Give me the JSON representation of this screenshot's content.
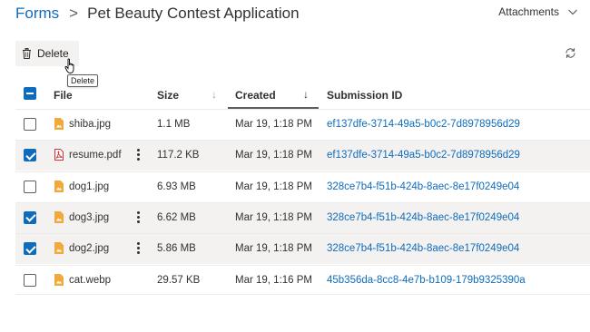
{
  "breadcrumb": {
    "root": "Forms",
    "separator": ">",
    "title": "Pet Beauty Contest Application"
  },
  "attachments_label": "Attachments",
  "toolbar": {
    "delete_label": "Delete",
    "tooltip": "Delete"
  },
  "columns": {
    "file": "File",
    "size": "Size",
    "created": "Created",
    "submission_id": "Submission ID"
  },
  "colors": {
    "accent": "#0f6cbd",
    "image_icon": "#f2a93b",
    "pdf_icon": "#d13438"
  },
  "rows": [
    {
      "name": "shiba.jpg",
      "size": "1.1 MB",
      "created": "Mar 19, 1:18 PM",
      "submission_id": "ef137dfe-3714-49a5-b0c2-7d8978956d29",
      "selected": false,
      "type": "image",
      "icon": "image-file-icon"
    },
    {
      "name": "resume.pdf",
      "size": "117.2 KB",
      "created": "Mar 19, 1:18 PM",
      "submission_id": "ef137dfe-3714-49a5-b0c2-7d8978956d29",
      "selected": true,
      "type": "pdf",
      "icon": "pdf-file-icon"
    },
    {
      "name": "dog1.jpg",
      "size": "6.93 MB",
      "created": "Mar 19, 1:18 PM",
      "submission_id": "328ce7b4-f51b-424b-8aec-8e17f0249e04",
      "selected": false,
      "type": "image",
      "icon": "image-file-icon"
    },
    {
      "name": "dog3.jpg",
      "size": "6.62 MB",
      "created": "Mar 19, 1:18 PM",
      "submission_id": "328ce7b4-f51b-424b-8aec-8e17f0249e04",
      "selected": true,
      "type": "image",
      "icon": "image-file-icon"
    },
    {
      "name": "dog2.jpg",
      "size": "5.86 MB",
      "created": "Mar 19, 1:18 PM",
      "submission_id": "328ce7b4-f51b-424b-8aec-8e17f0249e04",
      "selected": true,
      "type": "image",
      "icon": "image-file-icon"
    },
    {
      "name": "cat.webp",
      "size": "29.57 KB",
      "created": "Mar 19, 1:16 PM",
      "submission_id": "45b356da-8cc8-4e7b-b109-179b9325390a",
      "selected": false,
      "type": "image",
      "icon": "image-file-icon"
    }
  ]
}
